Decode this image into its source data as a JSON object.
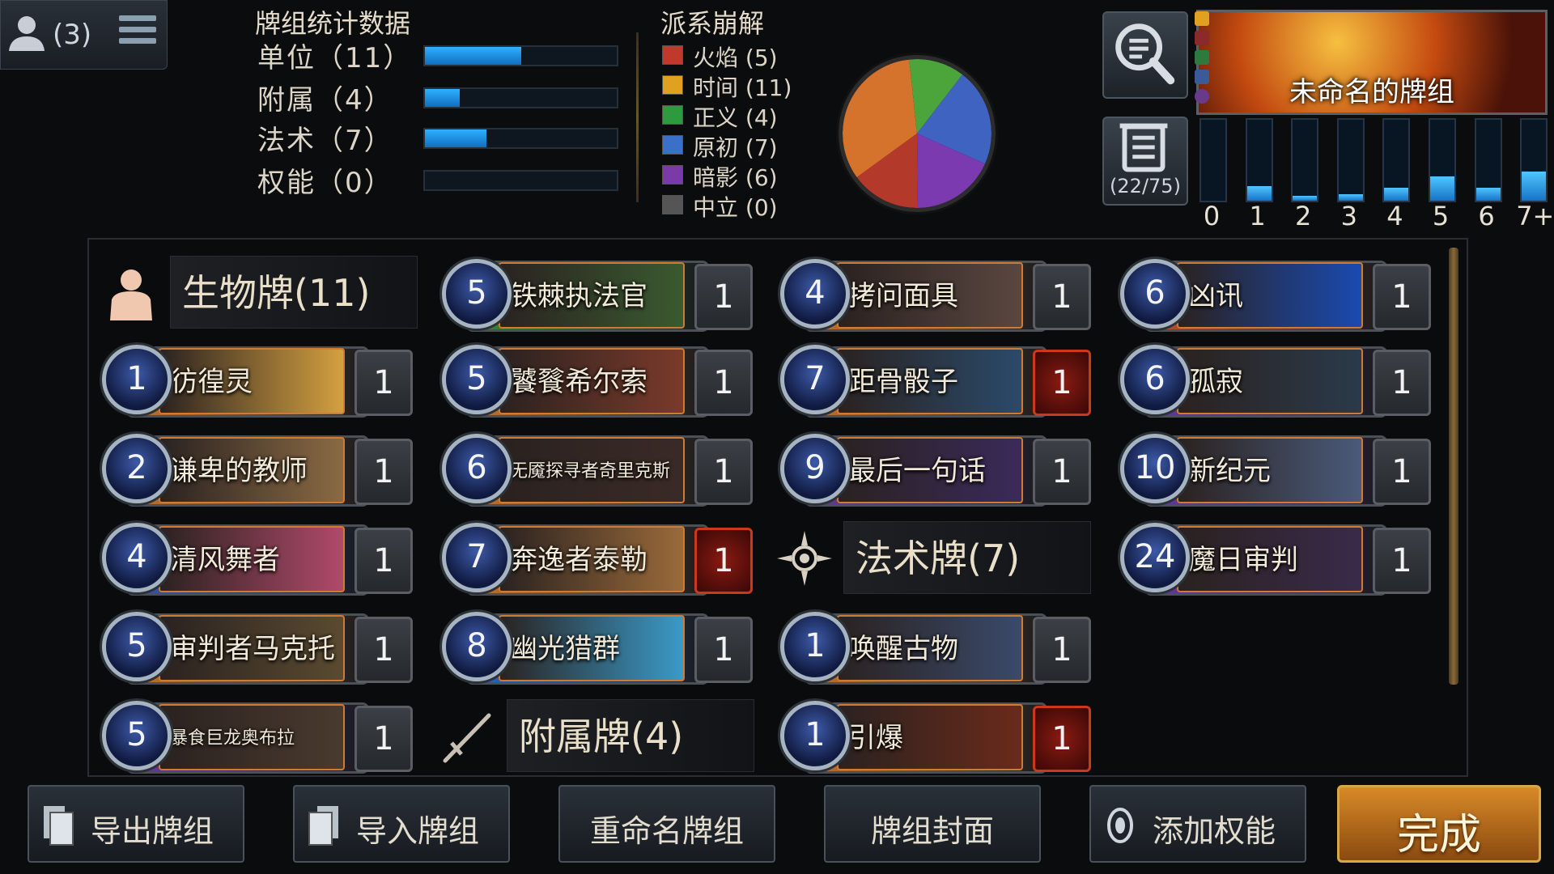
{
  "player": {
    "count": "(3)",
    "icon": "user-silhouette-icon",
    "menu_icon": "hamburger-menu-icon"
  },
  "stats": {
    "title": "牌组统计数据",
    "rows": [
      {
        "label": "单位（11）",
        "fill": 0.5
      },
      {
        "label": "附属（4）",
        "fill": 0.18
      },
      {
        "label": "法术（7）",
        "fill": 0.32
      },
      {
        "label": "权能（0）",
        "fill": 0
      }
    ]
  },
  "factions": {
    "title": "派系崩解",
    "rows": [
      {
        "label": "火焰 (5)",
        "color": "#c0392b"
      },
      {
        "label": "时间 (11)",
        "color": "#e0a020"
      },
      {
        "label": "正义 (4)",
        "color": "#2e9a3e"
      },
      {
        "label": "原初 (7)",
        "color": "#3a70c8"
      },
      {
        "label": "暗影 (6)",
        "color": "#7a3aa8"
      },
      {
        "label": "中立 (0)",
        "color": "#555555"
      }
    ],
    "pie_colors": [
      "#d5722b",
      "#4ba53a",
      "#3e63c0",
      "#7b3ab0",
      "#b33a2a"
    ],
    "pie_values": [
      11,
      4,
      7,
      6,
      5
    ]
  },
  "deck": {
    "name": "未命名的牌组",
    "search_icon": "magnifier-icon",
    "cards_icon": "card-list-icon",
    "cards_count": "(22/75)"
  },
  "curve": {
    "labels": [
      "0",
      "1",
      "2",
      "3",
      "4",
      "5",
      "6",
      "7+"
    ],
    "values": [
      0,
      0.18,
      0.06,
      0.08,
      0.16,
      0.3,
      0.16,
      0.36
    ]
  },
  "sections": {
    "creatures": {
      "title": "生物牌(11)",
      "icon": "unit-person-icon"
    },
    "spells": {
      "title": "法术牌(7)",
      "icon": "spell-compass-icon"
    },
    "attachments": {
      "title": "附属牌(4)",
      "icon": "sword-icon"
    }
  },
  "cards": [
    {
      "cost": "1",
      "name": "彷徨灵",
      "qty": "1",
      "plate": "#c5762e",
      "art": "#d4a040",
      "legend": false
    },
    {
      "cost": "2",
      "name": "谦卑的教师",
      "qty": "1",
      "plate": "#c5762e",
      "art": "#8a6a44",
      "legend": false
    },
    {
      "cost": "4",
      "name": "清风舞者",
      "qty": "1",
      "plate": "#3a5aa8",
      "art": "#b04a6a",
      "legend": false
    },
    {
      "cost": "5",
      "name": "审判者马克托",
      "qty": "1",
      "plate": "#c5762e",
      "art": "#5a4a30",
      "legend": false
    },
    {
      "cost": "5",
      "name": "暴食巨龙奥布拉",
      "qty": "1",
      "plate": "#6a3aa0",
      "art": "#4a3a2e",
      "legend": false
    },
    {
      "cost": "5",
      "name": "铁棘执法官",
      "qty": "1",
      "plate": "#3d8a3a",
      "art": "#3a5a30",
      "legend": false
    },
    {
      "cost": "5",
      "name": "饕餮希尔索",
      "qty": "1",
      "plate": "#c5762e",
      "art": "#7a3a2a",
      "legend": false
    },
    {
      "cost": "6",
      "name": "无魇探寻者奇里克斯",
      "qty": "1",
      "plate": "#c5762e",
      "art": "#3a2a26",
      "legend": false
    },
    {
      "cost": "7",
      "name": "奔逸者泰勒",
      "qty": "1",
      "plate": "#c5762e",
      "art": "#9a6a3a",
      "legend": true
    },
    {
      "cost": "8",
      "name": "幽光猎群",
      "qty": "1",
      "plate": "#2a6ac0",
      "art": "#3a9ac8",
      "legend": false
    },
    {
      "cost": "4",
      "name": "拷问面具",
      "qty": "1",
      "plate": "#c5762e",
      "art": "#5a4640",
      "legend": false
    },
    {
      "cost": "7",
      "name": "距骨骰子",
      "qty": "1",
      "plate": "#c5762e",
      "art": "#2a4a6a",
      "legend": true
    },
    {
      "cost": "9",
      "name": "最后一句话",
      "qty": "1",
      "plate": "#6a3aa0",
      "art": "#3a2a5a",
      "legend": false
    },
    {
      "cost": "1",
      "name": "唤醒古物",
      "qty": "1",
      "plate": "#c5762e",
      "art": "#3a4a6a",
      "legend": false
    },
    {
      "cost": "1",
      "name": "引爆",
      "qty": "1",
      "plate": "#c5762e",
      "art": "#6a2a1a",
      "legend": true
    },
    {
      "cost": "6",
      "name": "凶讯",
      "qty": "1",
      "plate": "#c8502e",
      "art": "#1a4ab0",
      "legend": false
    },
    {
      "cost": "6",
      "name": "孤寂",
      "qty": "1",
      "plate": "#6a3aa0",
      "art": "#2a3a4a",
      "legend": false
    },
    {
      "cost": "10",
      "name": "新纪元",
      "qty": "1",
      "plate": "#6a3aa0",
      "art": "#4a5a7a",
      "legend": false
    },
    {
      "cost": "24",
      "name": "魔日审判",
      "qty": "1",
      "plate": "#6a3aa0",
      "art": "#3a2a4a",
      "legend": false
    }
  ],
  "buttons": {
    "export": {
      "label": "导出牌组",
      "icon": "export-cards-icon"
    },
    "import": {
      "label": "导入牌组",
      "icon": "import-cards-icon"
    },
    "rename": {
      "label": "重命名牌组"
    },
    "cover": {
      "label": "牌组封面"
    },
    "add_power": {
      "label": "添加权能",
      "icon": "power-gem-icon"
    },
    "done": {
      "label": "完成"
    }
  }
}
